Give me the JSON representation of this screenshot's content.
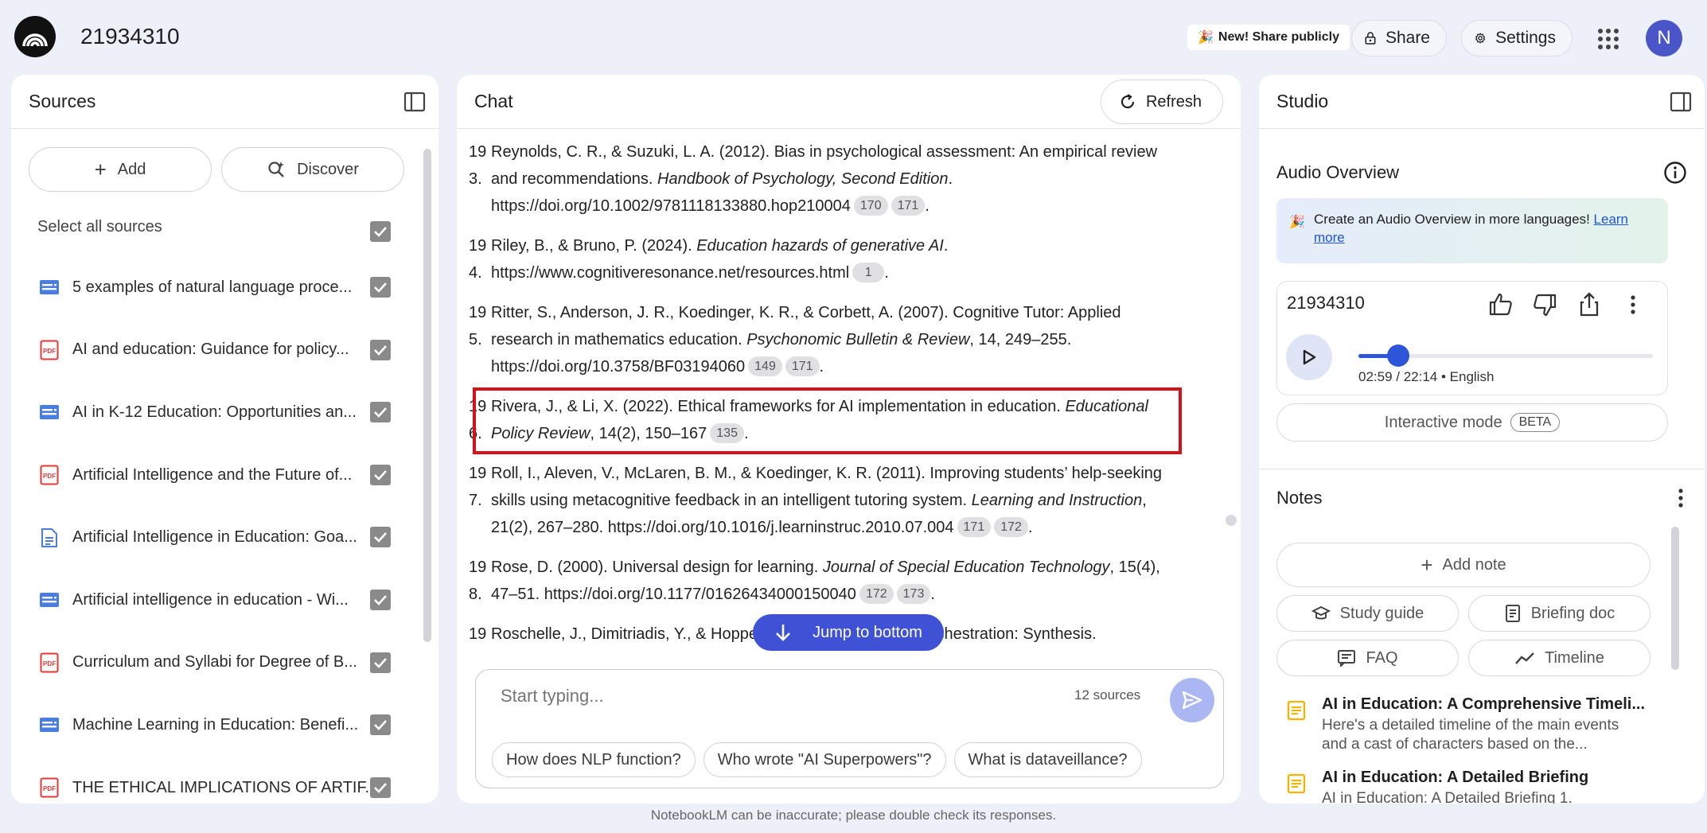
{
  "header": {
    "notebook_title": "21934310",
    "new_share_label": "New! Share publicly",
    "share_label": "Share",
    "settings_label": "Settings",
    "avatar_initial": "N"
  },
  "sources": {
    "title": "Sources",
    "add_label": "Add",
    "discover_label": "Discover",
    "select_all_label": "Select all sources",
    "items": [
      {
        "label": "5 examples of natural language proce...",
        "type": "web",
        "checked": true
      },
      {
        "label": "AI and education: Guidance for policy...",
        "type": "pdf",
        "checked": true
      },
      {
        "label": "AI in K-12 Education: Opportunities an...",
        "type": "web",
        "checked": true
      },
      {
        "label": "Artificial Intelligence and the Future of...",
        "type": "pdf",
        "checked": true
      },
      {
        "label": "Artificial Intelligence in Education: Goa...",
        "type": "doc",
        "checked": true
      },
      {
        "label": "Artificial intelligence in education - Wi...",
        "type": "web",
        "checked": true
      },
      {
        "label": "Curriculum and Syllabi for Degree of B...",
        "type": "pdf",
        "checked": true
      },
      {
        "label": "Machine Learning in Education: Benefi...",
        "type": "web",
        "checked": true
      },
      {
        "label": "THE ETHICAL IMPLICATIONS OF ARTIF...",
        "type": "pdf",
        "checked": true
      }
    ]
  },
  "chat": {
    "title": "Chat",
    "refresh_label": "Refresh",
    "jump_label": "Jump to bottom",
    "input_placeholder": "Start typing...",
    "source_count": "12 sources",
    "suggestions": [
      "How does NLP function?",
      "Who wrote \"AI Superpowers\"?",
      "What is dataveillance?"
    ],
    "references": [
      {
        "num": "19\n3.",
        "before": "Reynolds, C. R., & Suzuki, L. A. (2012). Bias in psychological assessment: An empirical review and recommendations. ",
        "italic": "Handbook of Psychology, Second Edition",
        "after": ". https://doi.org/10.1002/9781118133880.hop210004",
        "cites": [
          "170",
          "171"
        ]
      },
      {
        "num": "19\n4.",
        "before": "Riley, B., & Bruno, P. (2024). ",
        "italic": "Education hazards of generative AI",
        "after": ". https://www.cognitiveresonance.net/resources.html",
        "cites": [
          "1"
        ]
      },
      {
        "num": "19\n5.",
        "before": "Ritter, S., Anderson, J. R., Koedinger, K. R., & Corbett, A. (2007). Cognitive Tutor: Applied research in mathematics education. ",
        "italic": "Psychonomic Bulletin & Review",
        "after": ", 14, 249–255. https://doi.org/10.3758/BF03194060",
        "cites": [
          "149",
          "171"
        ]
      },
      {
        "num": "19\n6.",
        "before": "Rivera, J., & Li, X. (2022). Ethical frameworks for AI implementation in education. ",
        "italic": "Educational Policy Review",
        "after": ", 14(2), 150–167",
        "cites": [
          "135"
        ]
      },
      {
        "num": "19\n7.",
        "before": "Roll, I., Aleven, V., McLaren, B. M., & Koedinger, K. R. (2011). Improving students’ help-seeking skills using metacognitive feedback in an intelligent tutoring system. ",
        "italic": "Learning and Instruction",
        "after": ", 21(2), 267–280. https://doi.org/10.1016/j.learninstruc.2010.07.004",
        "cites": [
          "171",
          "172"
        ]
      },
      {
        "num": "19\n8.",
        "before": "Rose, D. (2000). Universal design for learning. ",
        "italic": "Journal of Special Education Technology",
        "after": ", 15(4), 47–51. https://doi.org/10.1177/01626434000150040",
        "cites": [
          "172",
          "173"
        ]
      },
      {
        "num": "19",
        "before": "Roschelle, J., Dimitriadis, Y., & Hoppe, U. (2013). Classroom orchestration: Synthesis.",
        "italic": "",
        "after": "",
        "cites": []
      }
    ]
  },
  "studio": {
    "title": "Studio",
    "audio_overview_title": "Audio Overview",
    "promo_text": "Create an Audio Overview in more languages! ",
    "promo_link": "Learn more",
    "audio_title": "21934310",
    "audio_time": "02:59 / 22:14 • English",
    "audio_progress": 0.135,
    "interactive_label": "Interactive mode",
    "beta_label": "BETA",
    "notes_title": "Notes",
    "add_note_label": "Add note",
    "study_guide_label": "Study guide",
    "briefing_doc_label": "Briefing doc",
    "faq_label": "FAQ",
    "timeline_label": "Timeline",
    "notes": [
      {
        "title": "AI in Education: A Comprehensive Timeli...",
        "subtitle": "Here's a detailed timeline of the main events and a cast of characters based on the..."
      },
      {
        "title": "AI in Education: A Detailed Briefing",
        "subtitle": "AI in Education: A Detailed Briefing 1."
      }
    ]
  },
  "footer": {
    "disclaimer": "NotebookLM can be inaccurate; please double check its responses."
  },
  "colors": {
    "accent": "#3f51d4",
    "highlight_border": "#d4121c",
    "pdf_red": "#e53935",
    "web_blue": "#4a7de0",
    "note_yellow": "#f2b400"
  }
}
